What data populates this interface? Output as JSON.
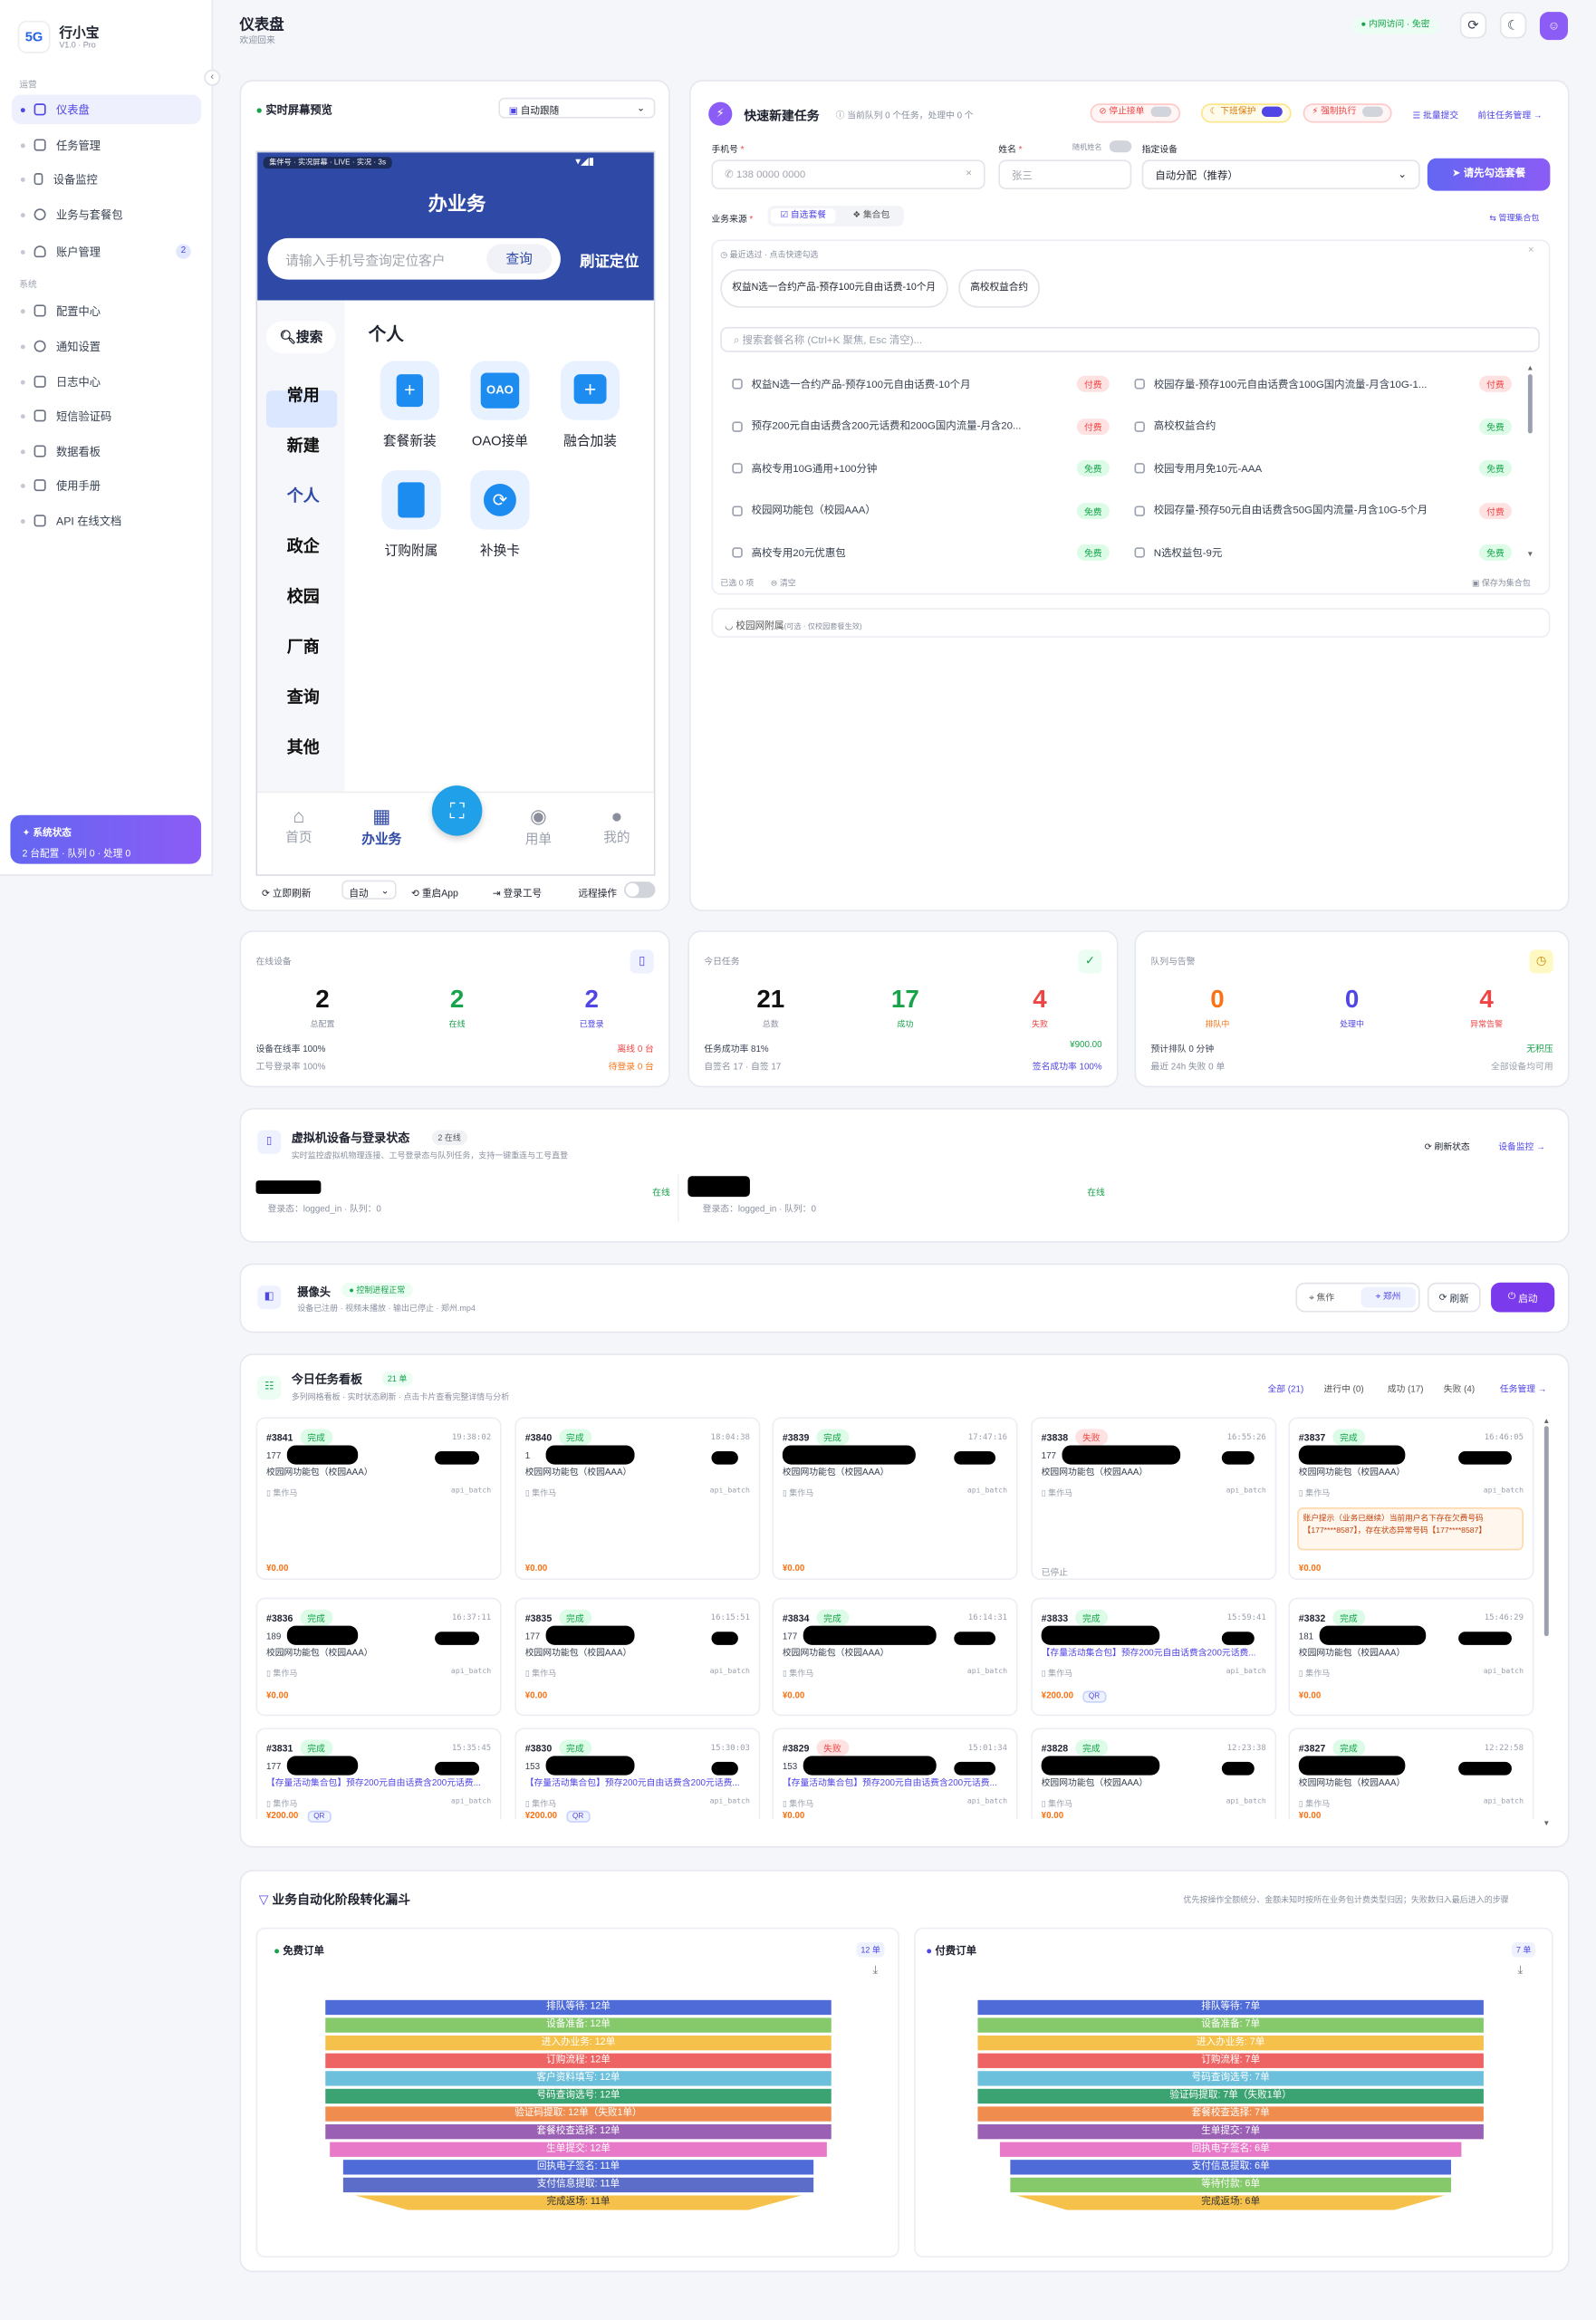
{
  "app": {
    "name": "行小宝",
    "version": "V1.0 · Pro",
    "logo_text": "5G"
  },
  "sidebar": {
    "sections": [
      {
        "label": "运营",
        "items": [
          {
            "label": "仪表盘",
            "active": true
          },
          {
            "label": "任务管理"
          },
          {
            "label": "设备监控"
          },
          {
            "label": "业务与套餐包"
          },
          {
            "label": "账户管理",
            "badge": "2"
          }
        ]
      },
      {
        "label": "系统",
        "items": [
          {
            "label": "配置中心"
          },
          {
            "label": "通知设置"
          },
          {
            "label": "日志中心"
          },
          {
            "label": "短信验证码"
          },
          {
            "label": "数据看板"
          },
          {
            "label": "使用手册"
          },
          {
            "label": "API 在线文档"
          }
        ]
      }
    ],
    "status": {
      "title": "系统状态",
      "detail": "2 台配置 · 队列 0 · 处理 0"
    }
  },
  "header": {
    "title": "仪表盘",
    "subtitle": "欢迎回来",
    "network_badge": "内网访问 · 免密"
  },
  "screen_preview": {
    "title": "实时屏幕预览",
    "follow_select": "自动跟随",
    "statusbar": "集伴号 · 实况屏幕 · LIVE · 实况 · 3s",
    "phone_title": "办业务",
    "search_placeholder": "请输入手机号查询定位客户",
    "search_btn": "查询",
    "locate_btn": "刷证定位",
    "search_side": "搜索",
    "menu": [
      "常用",
      "新建",
      "个人",
      "政企",
      "校园",
      "厂商",
      "查询",
      "其他"
    ],
    "active_menu": "个人",
    "section_title": "个人",
    "apps": [
      "套餐新装",
      "OAO接单",
      "融合加装",
      "订购附属",
      "补换卡"
    ],
    "oao_icon_text": "OAO",
    "tabs": [
      "首页",
      "办业务",
      "用单",
      "我的"
    ],
    "active_tab": "办业务",
    "controls": {
      "refresh": "立即刷新",
      "mode": "自动",
      "restart": "重启App",
      "login": "登录工号",
      "remote": "远程操作"
    }
  },
  "quick_task": {
    "title": "快速新建任务",
    "queue_info": "当前队列 0 个任务，处理中 0 个",
    "stop_label": "停止接单",
    "sleep_label": "下班保护",
    "force_label": "强制执行",
    "batch_label": "批量提交",
    "manage_label": "前往任务管理 →",
    "phone_label": "手机号",
    "phone_placeholder": "138 0000 0000",
    "name_label": "姓名",
    "name_placeholder": "张三",
    "random_label": "随机姓名",
    "device_label": "指定设备",
    "device_value": "自动分配（推荐）",
    "submit_btn": "请先勾选套餐",
    "source_label": "业务来源",
    "source_tabs": [
      "自选套餐",
      "集合包"
    ],
    "manage_pkg": "管理集合包",
    "recent_label": "最近选过 · 点击快速勾选",
    "recent": [
      "权益N选一合约产品-预存100元自由话费-10个月",
      "高校权益合约"
    ],
    "search_placeholder": "搜索套餐名称 (Ctrl+K 聚焦, Esc 清空)...",
    "packages": [
      {
        "name": "权益N选一合约产品-预存100元自由话费-10个月",
        "tag": "付费"
      },
      {
        "name": "校园存量-预存100元自由话费含100G国内流量-月含10G-1...",
        "tag": "付费"
      },
      {
        "name": "预存200元自由话费含200元话费和200G国内流量-月含20...",
        "tag": "付费"
      },
      {
        "name": "高校权益合约",
        "tag": "免费"
      },
      {
        "name": "高校专用10G通用+100分钟",
        "tag": "免费"
      },
      {
        "name": "校园专用月免10元-AAA",
        "tag": "免费"
      },
      {
        "name": "校园网功能包（校园AAA）",
        "tag": "免费"
      },
      {
        "name": "校园存量-预存50元自由话费含50G国内流量-月含10G-5个月",
        "tag": "付费"
      },
      {
        "name": "高校专用20元优惠包",
        "tag": "免费"
      },
      {
        "name": "N选权益包-9元",
        "tag": "免费"
      }
    ],
    "selected_count": "已选 0 项",
    "clear_label": "清空",
    "save_label": "保存为集合包",
    "attach_title": "校园网附属",
    "attach_note": "(可选 · 仅校园套餐生效)"
  },
  "stats": [
    {
      "title": "在线设备",
      "items": [
        {
          "value": "2",
          "label": "总配置"
        },
        {
          "value": "2",
          "label": "在线"
        },
        {
          "value": "2",
          "label": "已登录"
        }
      ],
      "rows": [
        [
          "设备在线率 100%",
          "离线 0 台"
        ],
        [
          "工号登录率 100%",
          "待登录 0 台"
        ]
      ]
    },
    {
      "title": "今日任务",
      "items": [
        {
          "value": "21",
          "label": "总数"
        },
        {
          "value": "17",
          "label": "成功"
        },
        {
          "value": "4",
          "label": "失败"
        }
      ],
      "rows": [
        [
          "任务成功率 81%",
          "¥900.00"
        ],
        [
          "自签名 17 · 自签 17",
          "签名成功率 100%"
        ]
      ]
    },
    {
      "title": "队列与告警",
      "items": [
        {
          "value": "0",
          "label": "排队中"
        },
        {
          "value": "0",
          "label": "处理中"
        },
        {
          "value": "4",
          "label": "异常告警"
        }
      ],
      "rows": [
        [
          "预计排队 0 分钟",
          "无积压"
        ],
        [
          "最近 24h 失败 0 单",
          "全部设备均可用"
        ]
      ]
    }
  ],
  "vm": {
    "title": "虚拟机设备与登录状态",
    "badge": "2 在线",
    "subtitle": "实时监控虚拟机物理连接、工号登录态与队列任务，支持一键重连与工号直登",
    "refresh": "刷新状态",
    "monitor": "设备监控 →",
    "devices": [
      {
        "status": "在线",
        "detail": "登录态：logged_in · 队列：0"
      },
      {
        "status": "在线",
        "detail": "登录态：logged_in · 队列：0"
      }
    ]
  },
  "camera": {
    "title": "摄像头",
    "badge": "控制进程正常",
    "subtitle": "设备已注册 · 视频未播放 · 输出已停止 · 郑州.mp4",
    "loc1": "焦作",
    "loc2": "郑州",
    "refresh": "刷新",
    "start": "启动"
  },
  "board": {
    "title": "今日任务看板",
    "count": "21 单",
    "subtitle": "多列网格看板 · 实时状态刷新 · 点击卡片查看完整详情与分析",
    "filters": [
      "全部 (21)",
      "进行中 (0)",
      "成功 (17)",
      "失败 (4)"
    ],
    "manage": "任务管理 →",
    "tasks": [
      {
        "no": "#3841",
        "status": "完成",
        "time": "19:38:02",
        "phone": "177",
        "pkg": "校园网功能包（校园AAA）",
        "amount": "¥0.00"
      },
      {
        "no": "#3840",
        "status": "完成",
        "time": "18:04:38",
        "phone": "1",
        "pkg": "校园网功能包（校园AAA）",
        "amount": "¥0.00"
      },
      {
        "no": "#3839",
        "status": "完成",
        "time": "17:47:16",
        "phone": "",
        "pkg": "校园网功能包（校园AAA）",
        "amount": "¥0.00"
      },
      {
        "no": "#3838",
        "status": "失败",
        "time": "16:55:26",
        "phone": "177",
        "pkg": "校园网功能包（校园AAA）",
        "amount": "已停止"
      },
      {
        "no": "#3837",
        "status": "完成",
        "time": "16:46:05",
        "phone": "",
        "pkg": "校园网功能包（校园AAA）",
        "amount": "¥0.00",
        "alert": "账户提示（业务已继续）当前用户名下存在欠费号码【177****8587】，存在状态异常号码【177****8587】"
      },
      {
        "no": "#3836",
        "status": "完成",
        "time": "16:37:11",
        "phone": "189",
        "pkg": "校园网功能包（校园AAA）",
        "amount": "¥0.00"
      },
      {
        "no": "#3835",
        "status": "完成",
        "time": "16:15:51",
        "phone": "177",
        "pkg": "校园网功能包（校园AAA）",
        "amount": "¥0.00"
      },
      {
        "no": "#3834",
        "status": "完成",
        "time": "16:14:31",
        "phone": "177",
        "pkg": "校园网功能包（校园AAA）",
        "amount": "¥0.00"
      },
      {
        "no": "#3833",
        "status": "完成",
        "time": "15:59:41",
        "phone": "",
        "pkg": "【存量活动集合包】预存200元自由话费含200元话费...",
        "amount": "¥200.00",
        "qr": "QR"
      },
      {
        "no": "#3832",
        "status": "完成",
        "time": "15:46:29",
        "phone": "181",
        "pkg": "校园网功能包（校园AAA）",
        "amount": "¥0.00"
      },
      {
        "no": "#3831",
        "status": "完成",
        "time": "15:35:45",
        "phone": "177",
        "pkg": "【存量活动集合包】预存200元自由话费含200元话费...",
        "amount": "¥200.00",
        "qr": "QR"
      },
      {
        "no": "#3830",
        "status": "完成",
        "time": "15:30:03",
        "phone": "153",
        "pkg": "【存量活动集合包】预存200元自由话费含200元话费...",
        "amount": "¥200.00",
        "qr": "QR"
      },
      {
        "no": "#3829",
        "status": "失败",
        "time": "15:01:34",
        "phone": "153",
        "pkg": "【存量活动集合包】预存200元自由话费含200元话费...",
        "amount": "¥0.00"
      },
      {
        "no": "#3828",
        "status": "完成",
        "time": "12:23:38",
        "phone": "",
        "pkg": "校园网功能包（校园AAA）",
        "amount": "¥0.00"
      },
      {
        "no": "#3827",
        "status": "完成",
        "time": "12:22:58",
        "phone": "",
        "pkg": "校园网功能包（校园AAA）",
        "amount": "¥0.00"
      }
    ],
    "operator": "集作马",
    "source": "api_batch"
  },
  "funnel": {
    "title": "业务自动化阶段转化漏斗",
    "note": "优先按操作全额统分、金额未知时按所在业务包计费类型归因；失败数归入最后进入的步骤",
    "free": {
      "title": "免费订单",
      "count": "12 单",
      "stages": [
        "排队等待: 12单",
        "设备准备: 12单",
        "进入办业务: 12单",
        "订购流程: 12单",
        "客户资料填写: 12单",
        "号码查询选号: 12单",
        "验证码提取: 12单（失败1单）",
        "套餐校查选择: 12单",
        "生单提交: 12单",
        "回执电子签名: 11单",
        "支付信息提取: 11单",
        "完成返场: 11单"
      ]
    },
    "paid": {
      "title": "付费订单",
      "count": "7 单",
      "stages": [
        "排队等待: 7单",
        "设备准备: 7单",
        "进入办业务: 7单",
        "订购流程: 7单",
        "号码查询选号: 7单",
        "验证码提取: 7单（失败1单）",
        "套餐校查选择: 7单",
        "生单提交: 7单",
        "回执电子签名: 6单",
        "支付信息提取: 6单",
        "等待付款: 6单",
        "完成返场: 6单"
      ]
    }
  }
}
